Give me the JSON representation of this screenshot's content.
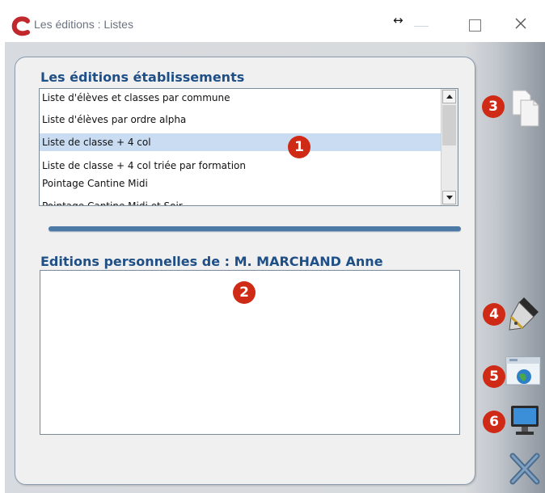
{
  "window": {
    "title": "Les éditions : Listes",
    "resize_glyph": "↔"
  },
  "sections": {
    "etablissement_title": "Les éditions établissements",
    "personnel_title": "Editions personnelles de : M.  MARCHAND Anne"
  },
  "list": {
    "items": [
      "Liste d'élèves et classes par commune",
      "Liste d'élèves par ordre alpha",
      "Liste de classe + 4 col",
      "Liste de classe + 4 col triée par formation",
      "Pointage Cantine Midi",
      "Pointage Cantine Midi et Soir"
    ],
    "selected_index": 2
  },
  "badges": [
    "1",
    "2",
    "3",
    "4",
    "5",
    "6"
  ],
  "toolbar": {
    "icons": [
      "copy-icon",
      "pen-icon",
      "web-window-icon",
      "monitor-icon",
      "close-x-icon"
    ]
  },
  "colors": {
    "accent": "#1e4f86",
    "badge": "#cf2a15",
    "selection": "#c9dcf2",
    "splitter": "#4d79a6"
  }
}
